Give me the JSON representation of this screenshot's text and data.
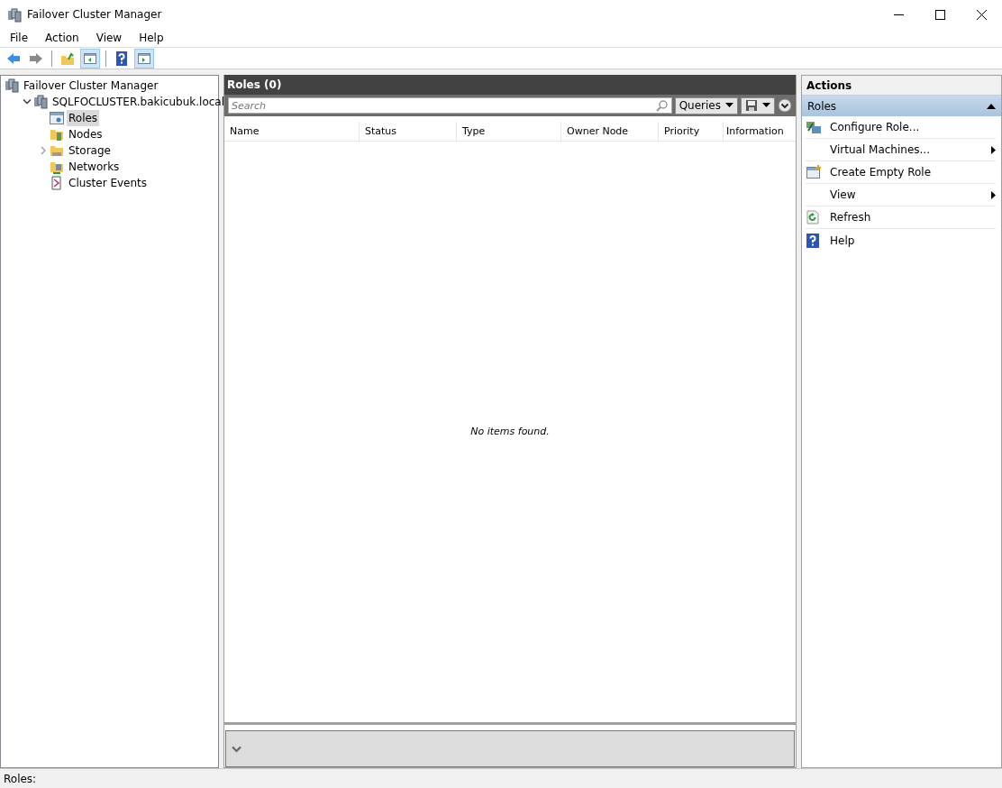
{
  "window": {
    "title": "Failover Cluster Manager"
  },
  "menu": [
    "File",
    "Action",
    "View",
    "Help"
  ],
  "toolbar": [
    {
      "kind": "back",
      "pressed": false
    },
    {
      "kind": "forward",
      "pressed": false
    },
    {
      "kind": "sep"
    },
    {
      "kind": "up",
      "pressed": false
    },
    {
      "kind": "tree-pane",
      "pressed": true
    },
    {
      "kind": "sep"
    },
    {
      "kind": "help",
      "pressed": false
    },
    {
      "kind": "action-pane",
      "pressed": true
    }
  ],
  "tree": [
    {
      "label": "Failover Cluster Manager",
      "kind": "cluster",
      "selected": false,
      "children": [
        {
          "label": "SQLFOCLUSTER.bakicubuk.local",
          "kind": "cluster",
          "selected": false,
          "expanded": true,
          "children": [
            {
              "label": "Roles",
              "kind": "roles",
              "selected": true
            },
            {
              "label": "Nodes",
              "kind": "nodes",
              "selected": false
            },
            {
              "label": "Storage",
              "kind": "storage",
              "selected": false,
              "expanded": false
            },
            {
              "label": "Networks",
              "kind": "networks",
              "selected": false
            },
            {
              "label": "Cluster Events",
              "kind": "events",
              "selected": false
            }
          ]
        }
      ]
    }
  ],
  "center": {
    "title": "Roles (0)",
    "search": {
      "placeholder": "Search"
    },
    "queries_button": "Queries",
    "table": {
      "columns": [
        "Name",
        "Status",
        "Type",
        "Owner Node",
        "Priority",
        "Information"
      ],
      "empty_message": "No items found."
    }
  },
  "actions": {
    "title": "Actions",
    "section": {
      "label": "Roles",
      "expanded": true
    },
    "items": [
      {
        "label": "Configure Role...",
        "kind": "configure"
      },
      {
        "label": "Virtual Machines...",
        "kind": "submenu"
      },
      {
        "label": "Create Empty Role",
        "kind": "create"
      },
      {
        "label": "View",
        "kind": "submenu"
      },
      {
        "label": "Refresh",
        "kind": "refresh"
      },
      {
        "label": "Help",
        "kind": "help"
      }
    ]
  },
  "status_bar": "Roles:"
}
